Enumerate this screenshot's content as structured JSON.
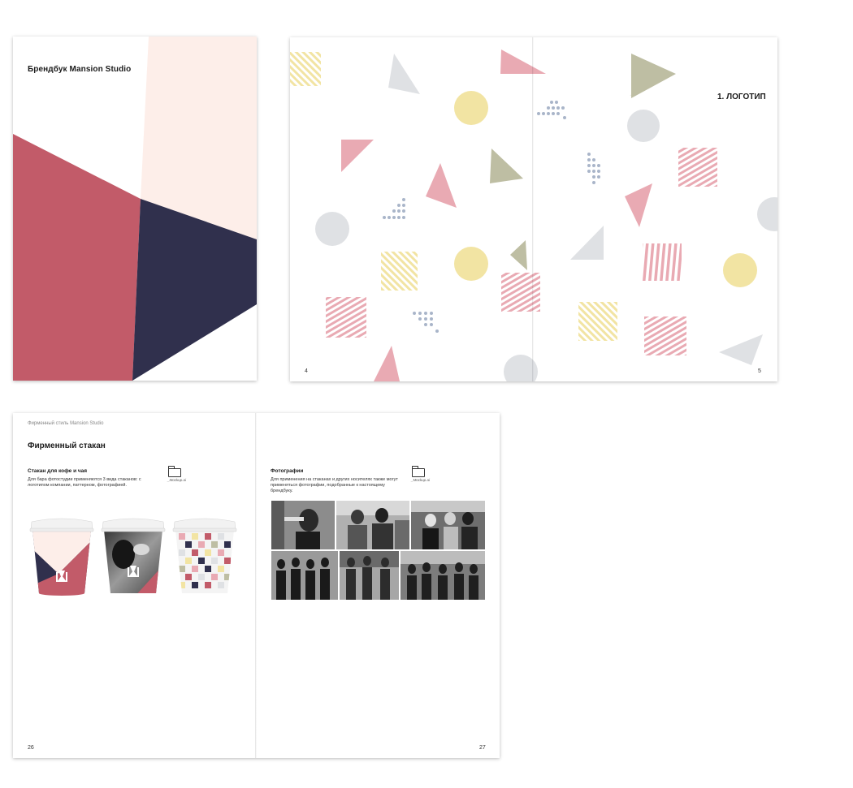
{
  "cover": {
    "title": "Брендбук Mansion Studio",
    "colors": {
      "pink_light": "#fdeee9",
      "rose": "#c25b69",
      "navy": "#30304d"
    }
  },
  "spread_logo": {
    "section_title": "1. ЛОГОТИП",
    "page_left": "4",
    "page_right": "5",
    "pattern_colors": {
      "pink": "#e9aab3",
      "yellow": "#f2e4a3",
      "olive": "#bebea3",
      "grey": "#dfe1e4",
      "dots": "#a9b5c9"
    }
  },
  "spread_cup": {
    "running_header": "Фирменный стиль Mansion Studio",
    "title": "Фирменный стакан",
    "left_block": {
      "heading": "Стакан для кофе и чая",
      "text": "Для бара фотостудии применяются 3 вида стаканов: с логотипом компании, паттерном, фотографией.",
      "folder_label": "_Mockup.ai"
    },
    "right_block": {
      "heading": "Фотографии",
      "text": "Для применения на стаканах и других носителях также могут применяться фотографии, подобранные к настоящему брендбуку.",
      "folder_label": "_Mockup.ai"
    },
    "cups": [
      "logo-cup",
      "photo-cup",
      "pattern-cup"
    ],
    "page_left": "26",
    "page_right": "27"
  }
}
